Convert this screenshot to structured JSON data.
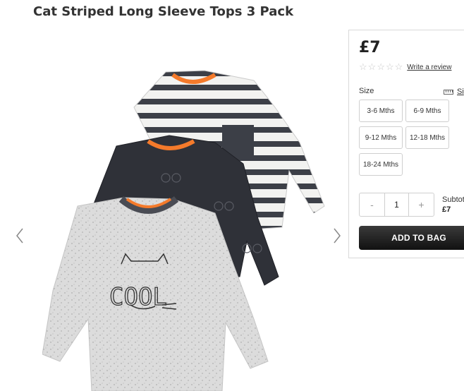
{
  "product": {
    "title": "Cat Striped Long Sleeve Tops 3 Pack",
    "image_alt": "Three long sleeve baby tops: grey striped, navy cat print, light grey with COOL cat print"
  },
  "gallery": {
    "prev_icon": "chevron-left-icon",
    "next_icon": "chevron-right-icon"
  },
  "purchase": {
    "price": "£7",
    "rating": {
      "stars": 0,
      "max": 5,
      "review_link": "Write a review"
    },
    "size_label": "Size",
    "size_guide_label": "Si",
    "sizes": [
      "3-6 Mths",
      "6-9 Mths",
      "9-12 Mths",
      "12-18 Mths",
      "18-24 Mths"
    ],
    "quantity": {
      "minus": "-",
      "value": "1",
      "plus": "+"
    },
    "subtotal_label": "Subtot",
    "subtotal_value": "£7",
    "add_to_bag": "ADD TO BAG"
  }
}
